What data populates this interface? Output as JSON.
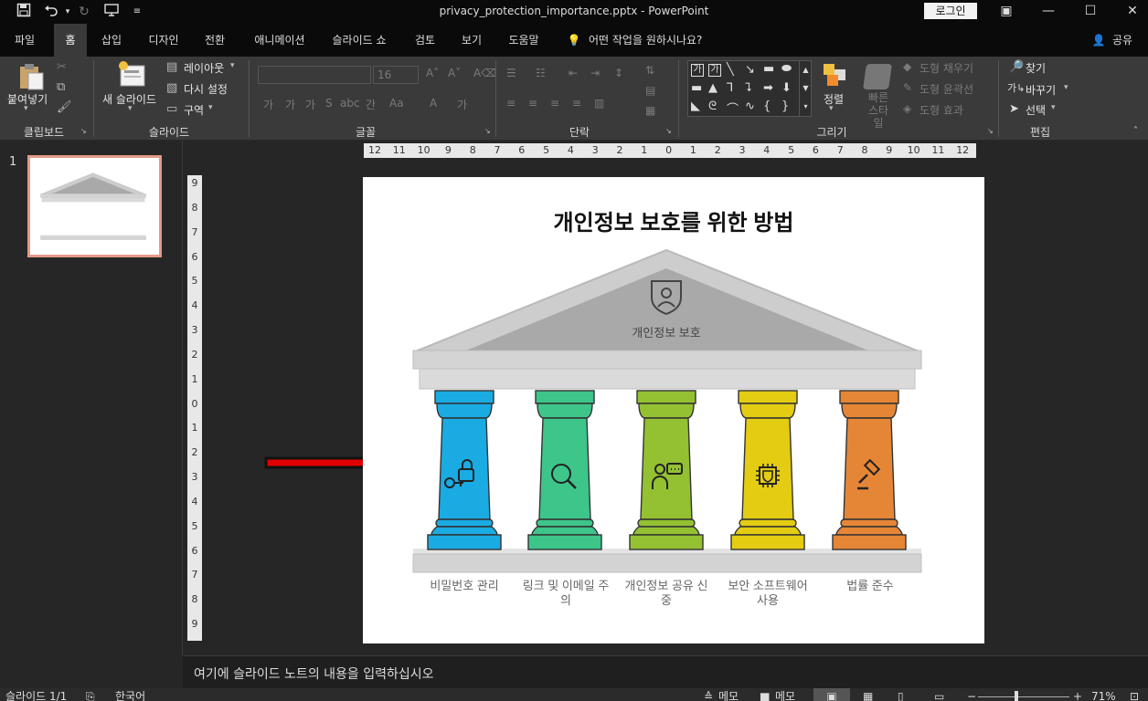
{
  "titlebar": {
    "title": "privacy_protection_importance.pptx  -  PowerPoint",
    "login_label": "로그인",
    "icons": [
      "save-icon",
      "undo-icon",
      "redo-icon",
      "slideshow-start-icon",
      "customize-qat-icon"
    ]
  },
  "tabs": [
    {
      "label": "파일"
    },
    {
      "label": "홈"
    },
    {
      "label": "삽입"
    },
    {
      "label": "디자인"
    },
    {
      "label": "전환"
    },
    {
      "label": "애니메이션"
    },
    {
      "label": "슬라이드 쇼"
    },
    {
      "label": "검토"
    },
    {
      "label": "보기"
    },
    {
      "label": "도움말"
    }
  ],
  "tell_me": "어떤 작업을 원하시나요?",
  "share_label": "공유",
  "ribbon": {
    "clipboard": {
      "paste": "붙여넣기",
      "group": "클립보드"
    },
    "slides": {
      "new_slide": "새 슬라이드",
      "layout": "레이아웃",
      "reset": "다시 설정",
      "section": "구역",
      "group": "슬라이드"
    },
    "font": {
      "size": "16",
      "group": "글꼴"
    },
    "paragraph": {
      "group": "단락"
    },
    "drawing": {
      "arrange": "정렬",
      "quick_styles": "빠른\n스타일",
      "fill": "도형 채우기",
      "outline": "도형 윤곽선",
      "effects": "도형 효과",
      "group": "그리기"
    },
    "editing": {
      "find": "찾기",
      "replace": "바꾸기",
      "select": "선택",
      "group": "편집"
    }
  },
  "thumbnail": {
    "number": "1"
  },
  "ruler": {
    "h": [
      "12",
      "11",
      "10",
      "9",
      "8",
      "7",
      "6",
      "5",
      "4",
      "3",
      "2",
      "1",
      "0",
      "1",
      "2",
      "3",
      "4",
      "5",
      "6",
      "7",
      "8",
      "9",
      "10",
      "11",
      "12"
    ],
    "v": [
      "9",
      "8",
      "7",
      "6",
      "5",
      "4",
      "3",
      "2",
      "1",
      "0",
      "1",
      "2",
      "3",
      "4",
      "5",
      "6",
      "7",
      "8",
      "9"
    ]
  },
  "slide": {
    "title": "개인정보 보호를 위한 방법",
    "roof_label": "개인정보 보호",
    "pillars": [
      {
        "label": "비밀번호 관리",
        "color": "#1aabe3",
        "icon": "lock-key-icon"
      },
      {
        "label": "링크 및 이메일 주의",
        "color": "#3dc58a",
        "icon": "magnifier-icon"
      },
      {
        "label": "개인정보 공유 신중",
        "color": "#93c132",
        "icon": "person-chat-icon"
      },
      {
        "label": "보안 소프트웨어 사용",
        "color": "#e3cc12",
        "icon": "security-chip-icon"
      },
      {
        "label": "법률 준수",
        "color": "#e58636",
        "icon": "gavel-icon"
      }
    ],
    "colors": {
      "roof": "#c9c9c9",
      "roof_inner": "#a9a9a9",
      "arrow": "#e00000"
    }
  },
  "notes": {
    "placeholder": "여기에 슬라이드 노트의 내용을 입력하십시오"
  },
  "status": {
    "slide": "슬라이드 1/1",
    "language": "한국어",
    "notes": "메모",
    "comments": "메모",
    "zoom": "71%"
  }
}
